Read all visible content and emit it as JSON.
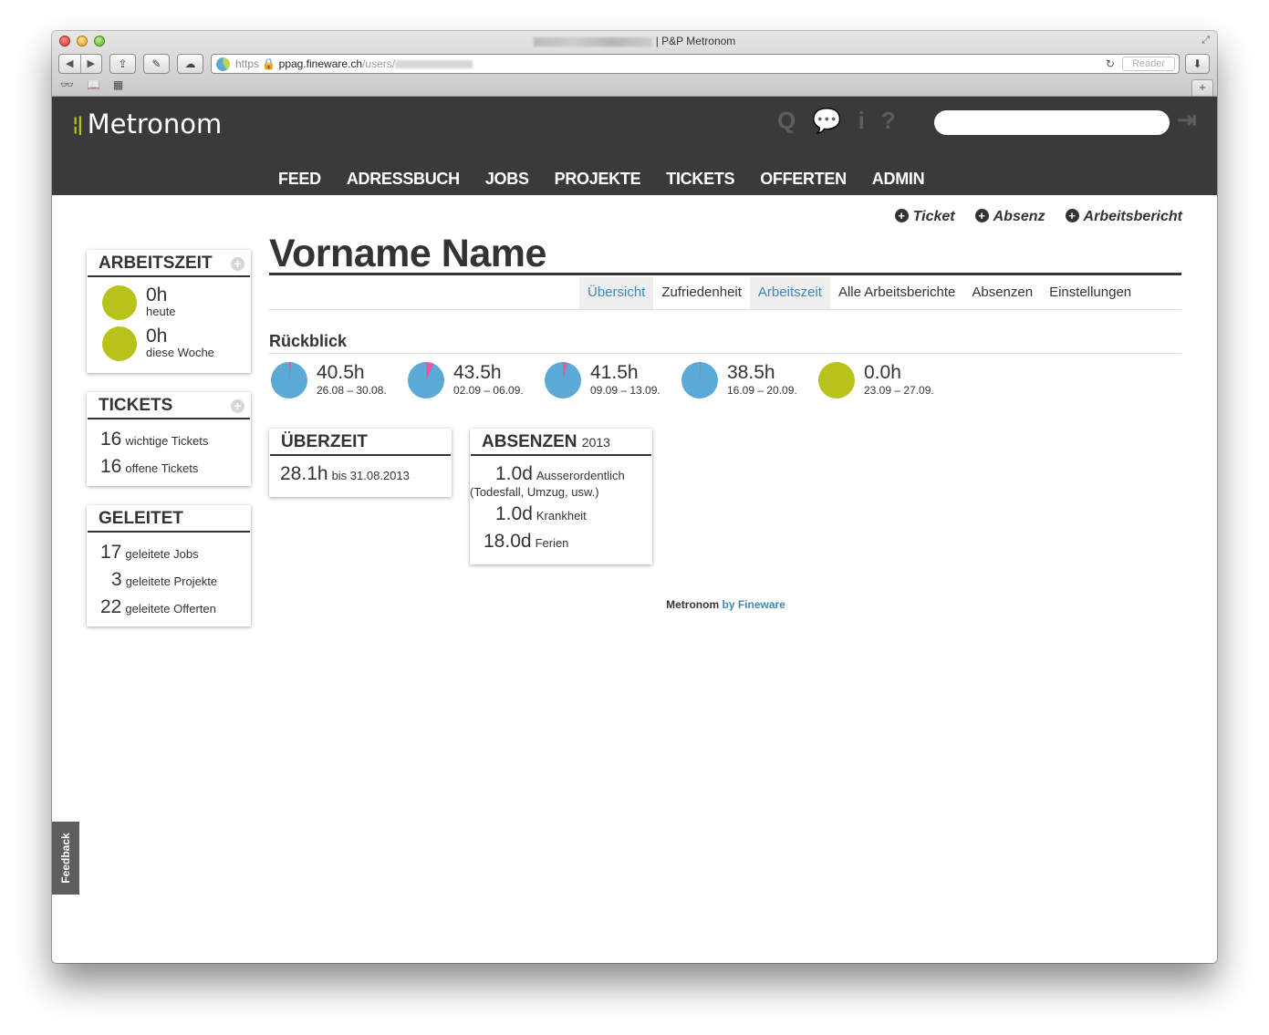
{
  "browser": {
    "window_title": "| P&P Metronom",
    "url_scheme": "https",
    "url_host": "ppag.fineware.ch",
    "url_path": "/users/",
    "reader_label": "Reader"
  },
  "header": {
    "logo_text": "Metronom",
    "nav": [
      "FEED",
      "ADRESSBUCH",
      "JOBS",
      "PROJEKTE",
      "TICKETS",
      "OFFERTEN",
      "ADMIN"
    ],
    "icons": [
      "search-icon",
      "chat-icon",
      "info-icon",
      "help-icon",
      "logout-icon"
    ]
  },
  "actions": [
    {
      "label": "Ticket"
    },
    {
      "label": "Absenz"
    },
    {
      "label": "Arbeitsbericht"
    }
  ],
  "sidebar": {
    "arbeitszeit": {
      "title": "ARBEITSZEIT",
      "rows": [
        {
          "value": "0h",
          "label": "heute"
        },
        {
          "value": "0h",
          "label": "diese Woche"
        }
      ]
    },
    "tickets": {
      "title": "TICKETS",
      "rows": [
        {
          "value": "16",
          "label": "wichtige Tickets"
        },
        {
          "value": "16",
          "label": "offene Tickets"
        }
      ]
    },
    "geleitet": {
      "title": "GELEITET",
      "rows": [
        {
          "value": "17",
          "label": "geleitete Jobs"
        },
        {
          "value": "3",
          "label": "geleitete Projekte"
        },
        {
          "value": "22",
          "label": "geleitete Offerten"
        }
      ]
    }
  },
  "main": {
    "title": "Vorname Name",
    "tabs": [
      {
        "label": "Übersicht",
        "active": true
      },
      {
        "label": "Zufriedenheit",
        "active": false
      },
      {
        "label": "Arbeitszeit",
        "active": true
      },
      {
        "label": "Alle Arbeitsberichte",
        "active": false
      },
      {
        "label": "Absenzen",
        "active": false
      },
      {
        "label": "Einstellungen",
        "active": false
      }
    ],
    "rueckblick": {
      "title": "Rückblick",
      "weeks": [
        {
          "hours": "40.5h",
          "range": "26.08 – 30.08.",
          "pink_fraction": 0.02,
          "color": "#5aa9d6"
        },
        {
          "hours": "43.5h",
          "range": "02.09 – 06.09.",
          "pink_fraction": 0.07,
          "color": "#5aa9d6"
        },
        {
          "hours": "41.5h",
          "range": "09.09 – 13.09.",
          "pink_fraction": 0.04,
          "color": "#5aa9d6"
        },
        {
          "hours": "38.5h",
          "range": "16.09 – 20.09.",
          "pink_fraction": 0.01,
          "color": "#5aa9d6"
        },
        {
          "hours": "0.0h",
          "range": "23.09 – 27.09.",
          "pink_fraction": 0,
          "color": "#b8c21b"
        }
      ]
    },
    "ueberzeit": {
      "title": "ÜBERZEIT",
      "value": "28.1h",
      "label": "bis 31.08.2013"
    },
    "absenzen": {
      "title": "ABSENZEN",
      "year": "2013",
      "rows": [
        {
          "value": "1.0d",
          "label": "Ausserordentlich",
          "note": "(Todesfall, Umzug, usw.)"
        },
        {
          "value": "1.0d",
          "label": "Krankheit"
        },
        {
          "value": "18.0d",
          "label": "Ferien"
        }
      ]
    }
  },
  "footer": {
    "brand": "Metronom",
    "by": "by Fineware"
  },
  "feedback_label": "Feedback",
  "colors": {
    "accent_green": "#b8c21b",
    "accent_blue": "#5aa9d6",
    "pink": "#e05aa6",
    "link_blue": "#3d87b8",
    "header_bg": "#3a3a3a"
  }
}
